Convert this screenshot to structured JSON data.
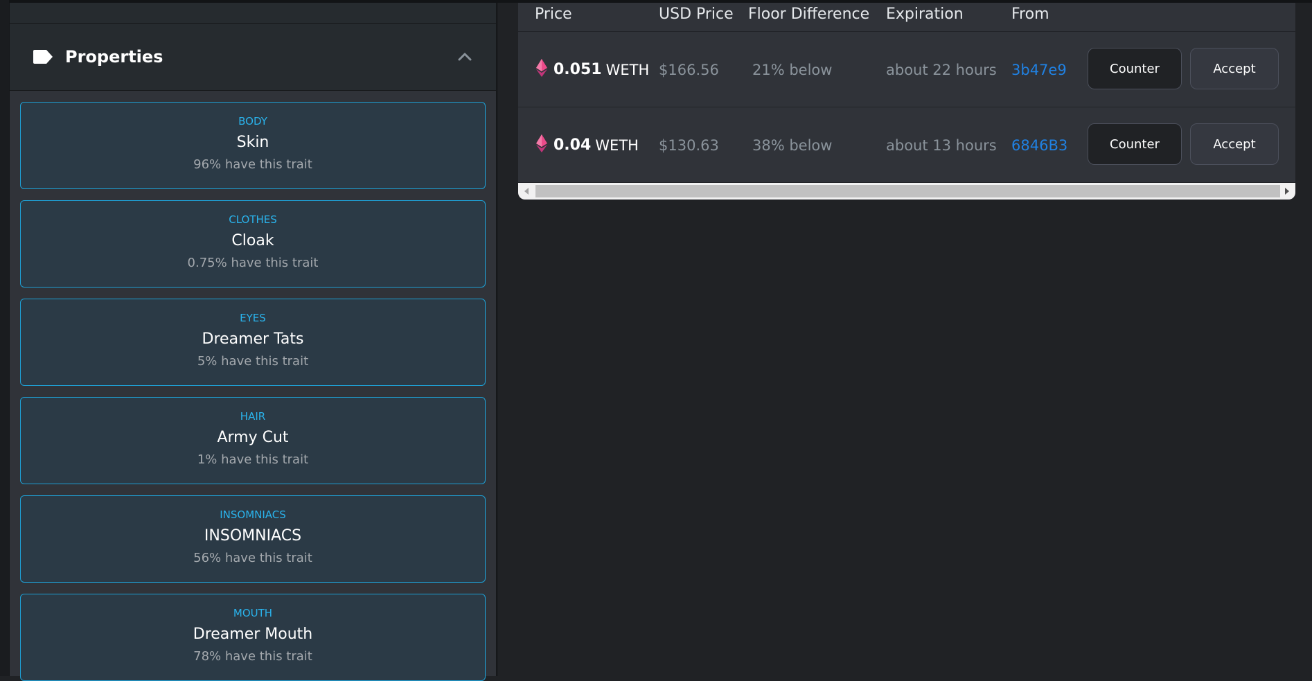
{
  "properties": {
    "title": "Properties",
    "traits": [
      {
        "type": "BODY",
        "value": "Skin",
        "rarity": "96% have this trait"
      },
      {
        "type": "CLOTHES",
        "value": "Cloak",
        "rarity": "0.75% have this trait"
      },
      {
        "type": "EYES",
        "value": "Dreamer Tats",
        "rarity": "5% have this trait"
      },
      {
        "type": "HAIR",
        "value": "Army Cut",
        "rarity": "1% have this trait"
      },
      {
        "type": "INSOMNIACS",
        "value": "INSOMNIACS",
        "rarity": "56% have this trait"
      },
      {
        "type": "MOUTH",
        "value": "Dreamer Mouth",
        "rarity": "78% have this trait"
      }
    ]
  },
  "offers": {
    "columns": {
      "price": "Price",
      "usd_price": "USD Price",
      "floor_difference": "Floor Difference",
      "expiration": "Expiration",
      "from": "From"
    },
    "rows": [
      {
        "price": "0.051",
        "currency": "WETH",
        "usd": "$166.56",
        "floor": "21% below",
        "expiration": "about 22 hours",
        "from": "3b47e9",
        "counter": "Counter",
        "accept": "Accept"
      },
      {
        "price": "0.04",
        "currency": "WETH",
        "usd": "$130.63",
        "floor": "38% below",
        "expiration": "about 13 hours",
        "from": "6846B3",
        "counter": "Counter",
        "accept": "Accept"
      }
    ]
  },
  "colors": {
    "trait_border": "#1ea0d5",
    "trait_type": "#2ab3ec",
    "link": "#2081e2",
    "eth_icon": "#eb4b8a"
  },
  "icons": {
    "tag": "tag-icon",
    "collapse": "chevron-up-icon",
    "currency": "weth-icon"
  }
}
